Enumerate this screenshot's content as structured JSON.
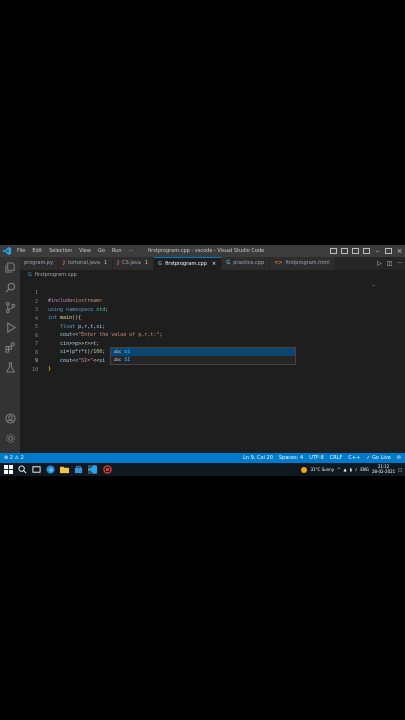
{
  "title_bar": {
    "menu": [
      "File",
      "Edit",
      "Selection",
      "View",
      "Go",
      "Run",
      "···"
    ],
    "window_title": "firstprogram.cpp - vscode - Visual Studio Code"
  },
  "tabs": [
    {
      "label": "program.py",
      "icon": "py",
      "modified": ""
    },
    {
      "label": "tortorial.java",
      "icon": "J",
      "modified": "1"
    },
    {
      "label": "CS.java",
      "icon": "J",
      "modified": "1"
    },
    {
      "label": "firstprogram.cpp",
      "icon": "G",
      "modified": "",
      "active": true,
      "close": "×"
    },
    {
      "label": "practice.cpp",
      "icon": "G",
      "modified": ""
    },
    {
      "label": "firstprogram.html",
      "icon": "<>",
      "modified": ""
    }
  ],
  "breadcrumb": {
    "file": "firstprogram.cpp",
    "icon": "G"
  },
  "editor": {
    "line_numbers": [
      "1",
      "2",
      "3",
      "4",
      "5",
      "6",
      "7",
      "8",
      "9",
      "10"
    ],
    "current_line": "9"
  },
  "suggestions": [
    {
      "kind": "abc",
      "text": "si",
      "match": "si"
    },
    {
      "kind": "abc",
      "text": "SI",
      "match": "SI"
    }
  ],
  "status_bar": {
    "left": "⊗ 2 ⚠ 2",
    "ln_col": "Ln 9, Col 20",
    "spaces": "Spaces: 4",
    "encoding": "UTF-8",
    "eol": "CRLF",
    "language": "C++",
    "go_live": "Go Live"
  },
  "taskbar": {
    "weather": "31°C Sunny",
    "language": "ENG",
    "time": "21:12",
    "date": "28-02-2021"
  },
  "colors": {
    "accent": "#007acc",
    "editor_bg": "#1e1e1e",
    "activity_bg": "#333333"
  }
}
